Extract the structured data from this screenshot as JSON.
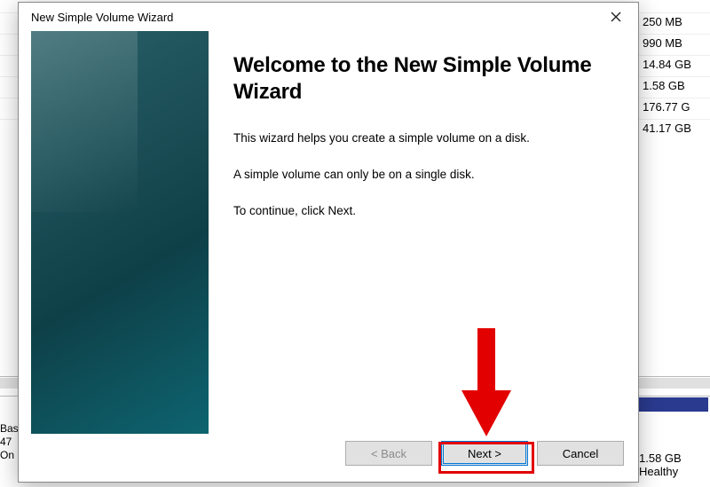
{
  "background": {
    "sizes": [
      "250 MB",
      "990 MB",
      "14.84 GB",
      "1.58 GB",
      "176.77 G",
      "41.17 GB"
    ],
    "disk_label_lines": [
      "Bas",
      "47",
      "On"
    ],
    "lower_size": "1.58 GB",
    "lower_status": "Healthy"
  },
  "dialog": {
    "title": "New Simple Volume Wizard",
    "heading": "Welcome to the New Simple Volume Wizard",
    "line1": "This wizard helps you create a simple volume on a disk.",
    "line2": "A simple volume can only be on a single disk.",
    "line3": "To continue, click Next.",
    "back_label": "< Back",
    "next_label": "Next >",
    "cancel_label": "Cancel"
  }
}
